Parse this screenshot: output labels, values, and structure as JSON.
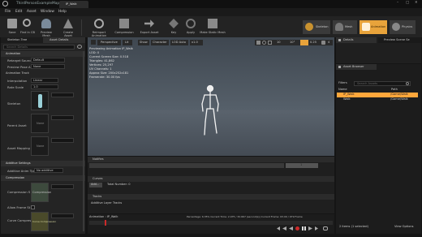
{
  "window": {
    "title": "ThirdPersonExampleMap",
    "tab": "IP_Walk"
  },
  "menu": [
    "File",
    "Edit",
    "Asset",
    "Window",
    "Help"
  ],
  "toolbar": {
    "buttons": [
      "Save",
      "Find in CB",
      "Preview Mesh",
      "Create Asset",
      "Reimport Animation",
      "Compression",
      "Export Asset",
      "Key",
      "Apply",
      "Make Static Mesh"
    ]
  },
  "modes": [
    "Skeleton",
    "Mesh",
    "Animation",
    "Physics"
  ],
  "left_panel": {
    "tabs": [
      "Skeleton Tree",
      "Asset Details"
    ],
    "search_placeholder": "Search Details",
    "sections": {
      "animation": "Animation",
      "compression": "Compression",
      "additive": "Additive Settings"
    },
    "props": {
      "retarget_source": {
        "label": "Retarget Source",
        "value": "Default"
      },
      "preview_pose_asset": {
        "label": "Preview Pose A",
        "value": "None"
      },
      "animation_track": "Animation Track",
      "interpolation": {
        "label": "Interpolation",
        "value": "Linear"
      },
      "rate_scale": {
        "label": "Rate Scale",
        "value": "1.0"
      },
      "skeleton": {
        "label": "Skeleton"
      },
      "parent_asset": {
        "label": "Parent Asset",
        "thumb": "None"
      },
      "asset_mapping": {
        "label": "Asset Mapping",
        "thumb": "None"
      },
      "additive_anim_type": {
        "label": "Additive Anim Type",
        "value": "No additive"
      },
      "compression_scheme": {
        "label": "Compression S",
        "thumb": "Compression"
      },
      "allow_frame_st": {
        "label": "Allow Frame St"
      },
      "curve_compression": {
        "label": "Curve Compres",
        "thumb": "Curve Compression"
      }
    }
  },
  "viewport": {
    "perspective": "Perspective",
    "lit": "Lit",
    "show": "Show",
    "character": "Character",
    "lod": "LOD Auto",
    "speed": "x1.0",
    "snap_values": [
      "10",
      "10°",
      "0.25",
      "4"
    ],
    "stats": [
      "Previewing Animation IP_Walk",
      "LOD: 0",
      "Current Screen Size: 0.518",
      "Triangles: 41,862",
      "Vertices: 25,297",
      "UV Channels: 1",
      "Approx Size: 200x252x181",
      "Framerate: 30.00 fps"
    ]
  },
  "timeline": {
    "notifies": "Notifies",
    "curves": "Curves",
    "add": "Add...",
    "total_number": "Total Number: 0",
    "tracks": "Tracks",
    "additive_layer": "Additive Layer Tracks",
    "marker": "1",
    "status": "Animation : IP_Walk",
    "percentage": "Percentage: 6.35%  Current Time: 2.075 / 32.667 (second(s)) Current Frame: 63.09 / 979 Frame"
  },
  "details": {
    "tabs": [
      "Details",
      "Preview Scene Se"
    ]
  },
  "asset_browser": {
    "tab": "Asset Browser",
    "filters": "Filters",
    "search_placeholder": "Search Assets",
    "columns": [
      "Name",
      "Path"
    ],
    "rows": [
      {
        "name": "IP_Walk",
        "path": "/Game/Walk"
      },
      {
        "name": "Walk",
        "path": "/Game/Walk"
      }
    ],
    "count": "2 items (1 selected)",
    "view_options": "View Options"
  },
  "colors": {
    "accent": "#e8a33b",
    "select": "#ffa73b",
    "play": "#cc2a2a",
    "viewport": "#48505a"
  }
}
